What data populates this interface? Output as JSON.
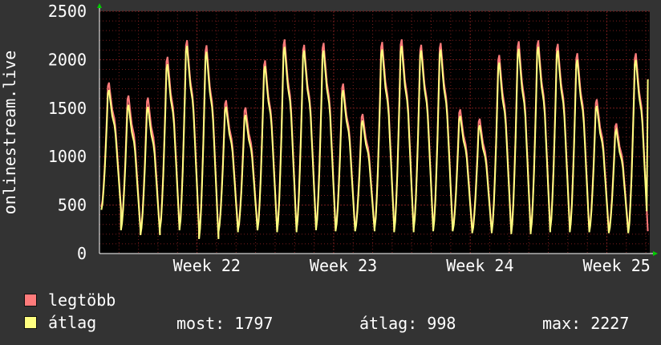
{
  "colors": {
    "background": "#333333",
    "plot_background": "#000000",
    "grid": "#7a1e1e",
    "text": "#ffffff",
    "axis_arrow": "#00cc00",
    "max_series": "#ff7b7b",
    "avg_series": "#ffff80"
  },
  "legend": {
    "max_label": "legtöbb",
    "avg_label": "átlag"
  },
  "stats": {
    "current": "most: 1797",
    "average": "átlag: 998",
    "max": "max: 2227"
  },
  "chart_data": {
    "type": "line",
    "ylabel": "onlinestream.live",
    "ylim": [
      0,
      2500
    ],
    "yticks": [
      0,
      500,
      1000,
      1500,
      2000,
      2500
    ],
    "xlim": [
      0,
      28.2
    ],
    "xtick_labels": [
      {
        "x": 5,
        "label": "Week 22"
      },
      {
        "x": 12,
        "label": "Week 23"
      },
      {
        "x": 19,
        "label": "Week 24"
      },
      {
        "x": 26,
        "label": "Week 25"
      }
    ],
    "x_unit": "days",
    "grid": true,
    "series": [
      {
        "name": "legtöbb",
        "color": "#ff7b7b",
        "daily_peaks": [
          1830,
          1700,
          1680,
          2120,
          2300,
          2250,
          1650,
          1570,
          2080,
          2310,
          2250,
          2270,
          1830,
          1500,
          2280,
          2310,
          2250,
          2270,
          1550,
          1450,
          2140,
          2290,
          2300,
          2260,
          2160,
          1660,
          1400,
          2160
        ],
        "daily_troughs": [
          480,
          260,
          210,
          270,
          260,
          170,
          240,
          260,
          260,
          240,
          260,
          270,
          250,
          250,
          280,
          240,
          270,
          250,
          250,
          230,
          240,
          220,
          240,
          270,
          240,
          240,
          230,
          230
        ]
      },
      {
        "name": "átlag",
        "color": "#ffff80",
        "daily_peaks": [
          1750,
          1600,
          1580,
          2040,
          2240,
          2180,
          1580,
          1490,
          2020,
          2230,
          2190,
          2190,
          1760,
          1430,
          2200,
          2240,
          2190,
          2200,
          1480,
          1380,
          2060,
          2210,
          2230,
          2190,
          2090,
          1590,
          1330,
          2090
        ],
        "daily_troughs": [
          450,
          240,
          190,
          250,
          240,
          150,
          220,
          240,
          240,
          220,
          240,
          250,
          230,
          230,
          260,
          220,
          250,
          230,
          230,
          210,
          220,
          200,
          220,
          250,
          220,
          220,
          210,
          210
        ],
        "last_value": 1797
      }
    ]
  }
}
